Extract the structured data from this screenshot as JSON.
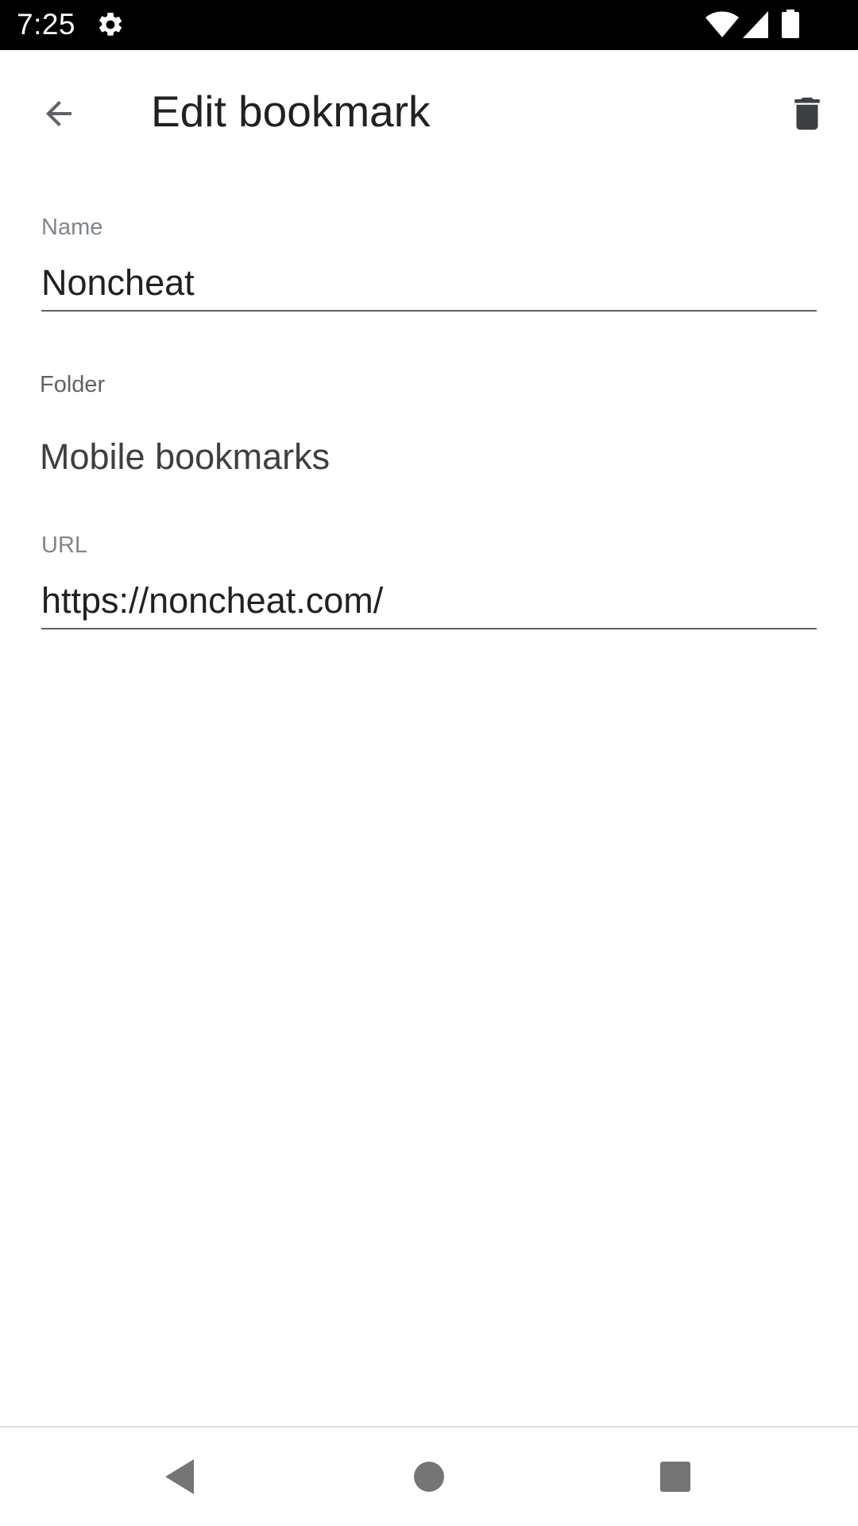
{
  "status_bar": {
    "time": "7:25",
    "icons": [
      "gear-icon",
      "wifi-icon",
      "signal-icon",
      "battery-icon"
    ]
  },
  "app_bar": {
    "title": "Edit bookmark",
    "back_icon": "arrow-back-icon",
    "delete_icon": "trash-icon"
  },
  "form": {
    "name": {
      "label": "Name",
      "value": "Noncheat"
    },
    "folder": {
      "label": "Folder",
      "value": "Mobile bookmarks"
    },
    "url": {
      "label": "URL",
      "value": "https://noncheat.com/"
    }
  },
  "nav_bar": {
    "icons": [
      "nav-back-icon",
      "nav-home-icon",
      "nav-recents-icon"
    ]
  },
  "colors": {
    "text_primary": "#202124",
    "label": "#80868b",
    "underline": "#5f6368",
    "icon": "#3c4043",
    "nav_icon": "#757575"
  }
}
